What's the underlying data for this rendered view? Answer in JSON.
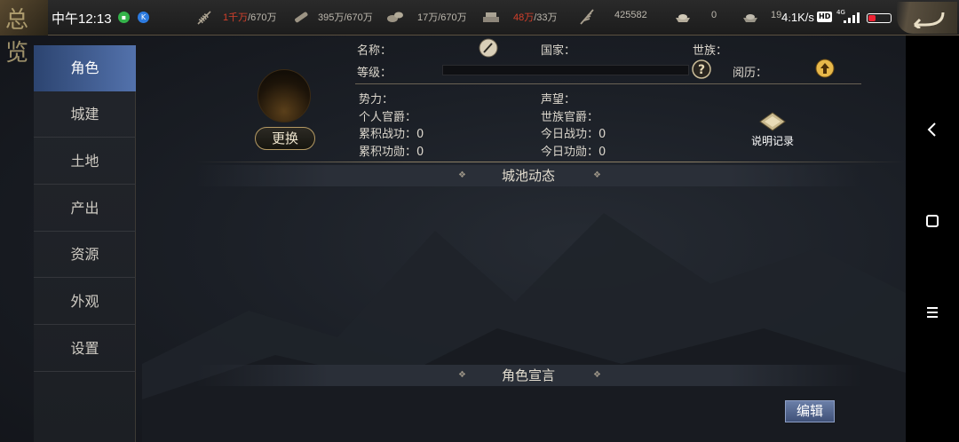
{
  "status_bar": {
    "time": "中午12:13",
    "net_speed": "4.1K/s",
    "hd_badge": "HD",
    "signal_label": "4G"
  },
  "corner_glyph": "总览",
  "resources": [
    {
      "icon": "wheat-icon",
      "current": "1千万",
      "max": "/670万",
      "warn": true
    },
    {
      "icon": "wood-icon",
      "current": "395万",
      "max": "/670万",
      "warn": false
    },
    {
      "icon": "stone-icon",
      "current": "17万",
      "max": "/670万",
      "warn": false
    },
    {
      "icon": "iron-icon",
      "current": "48万",
      "max": "/33万",
      "warn": true
    },
    {
      "icon": "feather-icon",
      "current": "425582",
      "max": "",
      "warn": false
    },
    {
      "icon": "gold-ingot-icon",
      "current": "0",
      "max": "",
      "warn": false
    },
    {
      "icon": "silver-ingot-icon",
      "current": "19…",
      "max": "",
      "warn": false
    }
  ],
  "sidebar": {
    "items": [
      {
        "label": "角色",
        "active": true
      },
      {
        "label": "城建",
        "active": false
      },
      {
        "label": "土地",
        "active": false
      },
      {
        "label": "产出",
        "active": false
      },
      {
        "label": "资源",
        "active": false
      },
      {
        "label": "外观",
        "active": false
      },
      {
        "label": "设置",
        "active": false
      }
    ]
  },
  "profile": {
    "change_button": "更换",
    "name_label": "名称：",
    "country_label": "国家：",
    "clan_label": "世族：",
    "level_label": "等级：",
    "experience_label": "阅历：",
    "power_label": "势力：",
    "prestige_label": "声望：",
    "personal_rank_label": "个人官爵：",
    "clan_rank_label": "世族官爵：",
    "total_battle_label": "累积战功：0",
    "today_battle_label": "今日战功：0",
    "total_merit_label": "累积功勋：0",
    "today_merit_label": "今日功勋：0",
    "explain_label": "说明记录"
  },
  "sections": {
    "city_dynamics": "城池动态",
    "declaration": "角色宣言"
  },
  "edit_button": "编辑",
  "colors": {
    "accent_blue": "#5372ac",
    "warn_red": "#d3402b",
    "gold_border": "#b59a63"
  }
}
